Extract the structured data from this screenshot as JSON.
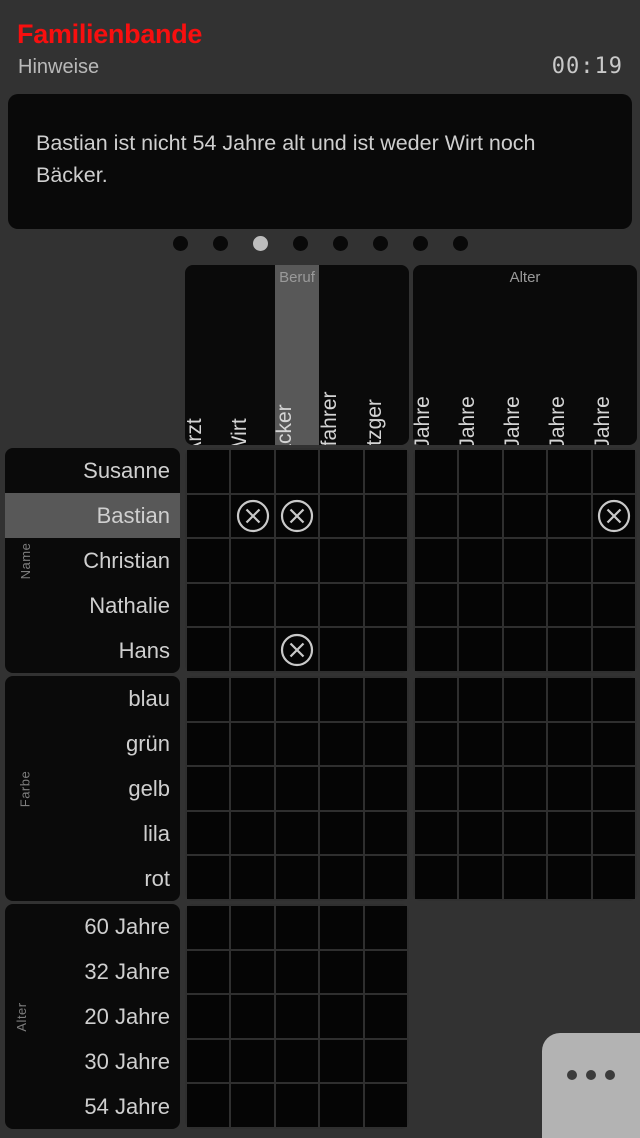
{
  "header": {
    "app_title": "Familienbande",
    "subtitle": "Hinweise",
    "timer": "00:19"
  },
  "hint": {
    "text": "Bastian ist nicht 54 Jahre alt und ist weder Wirt noch Bäcker.",
    "total_pages": 8,
    "active_page": 3
  },
  "colors": {
    "accent_red": "#f80f0f",
    "panel_bg": "#0a0a0a",
    "cell_bg": "#050505",
    "page_bg": "#323232",
    "highlight": "#585858",
    "mark_stroke": "#c9c9c9",
    "fab_bg": "#b3b3b3"
  },
  "categories": {
    "name": {
      "label": "Name",
      "values": [
        "Susanne",
        "Bastian",
        "Christian",
        "Nathalie",
        "Hans"
      ],
      "highlighted": "Bastian"
    },
    "beruf": {
      "label": "Beruf",
      "values": [
        "Arzt",
        "Wirt",
        "Bäcker",
        "Busfahrer",
        "Metzger"
      ],
      "highlighted": "Bäcker"
    },
    "farbe": {
      "label": "Farbe",
      "values": [
        "blau",
        "grün",
        "gelb",
        "lila",
        "rot"
      ],
      "highlighted": null
    },
    "alter": {
      "label": "Alter",
      "values": [
        "60 Jahre",
        "32 Jahre",
        "20 Jahre",
        "30 Jahre",
        "54 Jahre"
      ],
      "highlighted": null
    }
  },
  "grids": {
    "name_beruf": {
      "rows": "name",
      "cols": "beruf",
      "marks": [
        {
          "row": 1,
          "col": 1,
          "type": "x"
        },
        {
          "row": 1,
          "col": 2,
          "type": "x"
        },
        {
          "row": 4,
          "col": 2,
          "type": "x"
        }
      ]
    },
    "name_alter": {
      "rows": "name",
      "cols": "alter",
      "marks": [
        {
          "row": 1,
          "col": 4,
          "type": "x"
        }
      ]
    },
    "farbe_beruf": {
      "rows": "farbe",
      "cols": "beruf",
      "marks": []
    },
    "farbe_alter": {
      "rows": "farbe",
      "cols": "alter",
      "marks": []
    },
    "alter_beruf": {
      "rows": "alter",
      "cols": "beruf",
      "marks": []
    }
  },
  "menu_button": {
    "icon": "ellipsis-icon",
    "dot_count": 3
  }
}
